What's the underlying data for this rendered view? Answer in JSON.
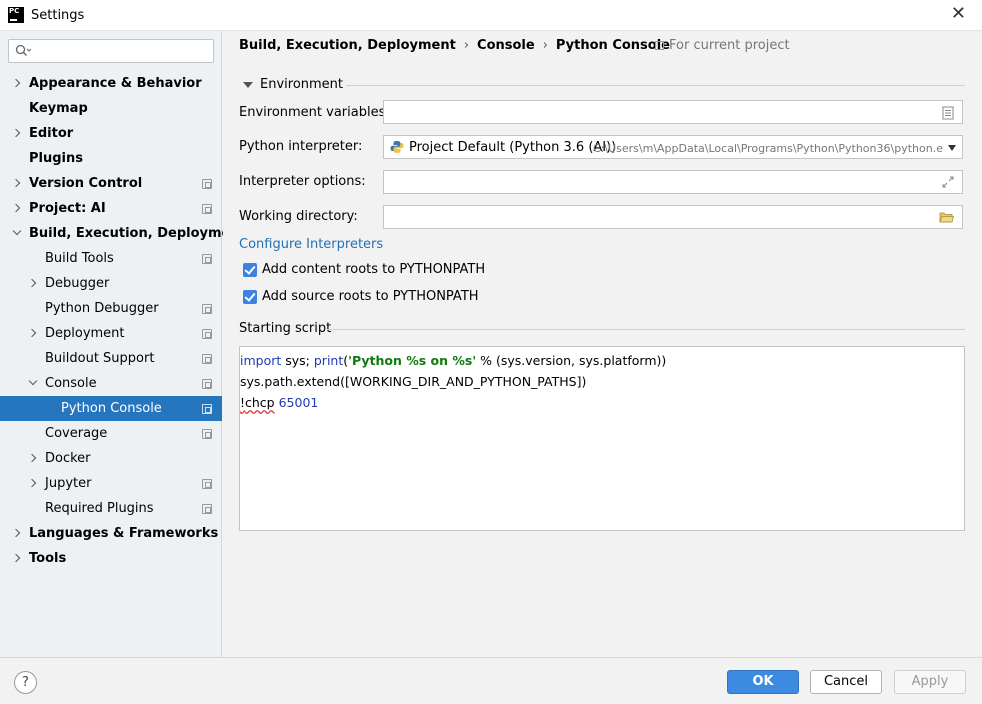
{
  "window": {
    "title": "Settings",
    "app_icon_text": "PC"
  },
  "sidebar": {
    "search_placeholder": "",
    "items": [
      {
        "label": "Appearance & Behavior",
        "level": 0,
        "arrow": "right",
        "project_icon": false
      },
      {
        "label": "Keymap",
        "level": 0,
        "arrow": "none",
        "project_icon": false
      },
      {
        "label": "Editor",
        "level": 0,
        "arrow": "right",
        "project_icon": false
      },
      {
        "label": "Plugins",
        "level": 0,
        "arrow": "none",
        "project_icon": false
      },
      {
        "label": "Version Control",
        "level": 0,
        "arrow": "right",
        "project_icon": true
      },
      {
        "label": "Project: AI",
        "level": 0,
        "arrow": "right",
        "project_icon": true
      },
      {
        "label": "Build, Execution, Deployment",
        "level": 0,
        "arrow": "down",
        "project_icon": false
      },
      {
        "label": "Build Tools",
        "level": 1,
        "arrow": "none",
        "project_icon": true
      },
      {
        "label": "Debugger",
        "level": 1,
        "arrow": "right",
        "project_icon": false
      },
      {
        "label": "Python Debugger",
        "level": 1,
        "arrow": "none",
        "project_icon": true
      },
      {
        "label": "Deployment",
        "level": 1,
        "arrow": "right",
        "project_icon": true
      },
      {
        "label": "Buildout Support",
        "level": 1,
        "arrow": "none",
        "project_icon": true
      },
      {
        "label": "Console",
        "level": 1,
        "arrow": "down",
        "project_icon": true
      },
      {
        "label": "Python Console",
        "level": 2,
        "arrow": "none",
        "project_icon": true,
        "selected": true
      },
      {
        "label": "Coverage",
        "level": 1,
        "arrow": "none",
        "project_icon": true
      },
      {
        "label": "Docker",
        "level": 1,
        "arrow": "right",
        "project_icon": false
      },
      {
        "label": "Jupyter",
        "level": 1,
        "arrow": "right",
        "project_icon": true
      },
      {
        "label": "Required Plugins",
        "level": 1,
        "arrow": "none",
        "project_icon": true
      },
      {
        "label": "Languages & Frameworks",
        "level": 0,
        "arrow": "right",
        "project_icon": false
      },
      {
        "label": "Tools",
        "level": 0,
        "arrow": "right",
        "project_icon": false
      }
    ]
  },
  "breadcrumb": {
    "parts": [
      "Build, Execution, Deployment",
      "Console",
      "Python Console"
    ],
    "separator": "›",
    "scope": "For current project"
  },
  "environment": {
    "section_label": "Environment",
    "env_vars_label": "Environment variables:",
    "env_vars_value": "",
    "interpreter_label": "Python interpreter:",
    "interpreter_name": "Project Default (Python 3.6 (AI))",
    "interpreter_path": "C:\\Users\\m\\AppData\\Local\\Programs\\Python\\Python36\\python.e",
    "options_label": "Interpreter options:",
    "options_value": "",
    "workdir_label": "Working directory:",
    "workdir_value": "",
    "configure_link": "Configure Interpreters",
    "add_content_roots": {
      "label": "Add content roots to PYTHONPATH",
      "checked": true
    },
    "add_source_roots": {
      "label": "Add source roots to PYTHONPATH",
      "checked": true
    }
  },
  "script": {
    "section_label": "Starting script",
    "line1": {
      "kw1": "import",
      "t1": " sys; ",
      "kw2": "print",
      "t2": "(",
      "str": "'Python %s on %s'",
      "t3": " % (sys.version, sys.platform))"
    },
    "line2": "sys.path.extend([WORKING_DIR_AND_PYTHON_PATHS])",
    "line3": {
      "t1": "!",
      "t2": "chcp",
      "t3": " ",
      "num": "65001"
    }
  },
  "buttons": {
    "help": "?",
    "ok": "OK",
    "cancel": "Cancel",
    "apply": "Apply"
  },
  "colors": {
    "accent": "#2675bf",
    "link": "#2470b3",
    "ok_button": "#3d8be0",
    "checkbox": "#3c82e0"
  }
}
